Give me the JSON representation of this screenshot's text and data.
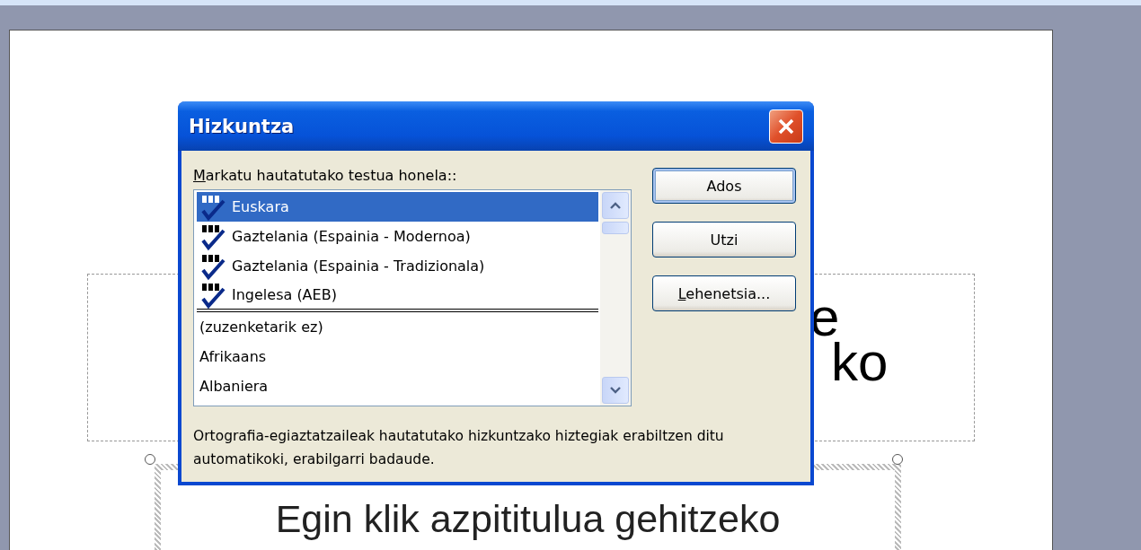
{
  "slide": {
    "title_fragments": [
      "e",
      "ko"
    ],
    "subtitle": "Egin klik azpititulua gehitzeko",
    "subtitle_selected": true
  },
  "dialog": {
    "title": "Hizkuntza",
    "label": "Markatu hautatutako testua honela::",
    "label_access_key_underlined": true,
    "languages": [
      {
        "name": "Euskara",
        "spellcheck": true,
        "selected": true,
        "divider_after": false
      },
      {
        "name": "Gaztelania (Espainia - Modernoa)",
        "spellcheck": true,
        "selected": false,
        "divider_after": false
      },
      {
        "name": "Gaztelania (Espainia - Tradizionala)",
        "spellcheck": true,
        "selected": false,
        "divider_after": false
      },
      {
        "name": "Ingelesa (AEB)",
        "spellcheck": true,
        "selected": false,
        "divider_after": true
      },
      {
        "name": "(zuzenketarik ez)",
        "spellcheck": false,
        "selected": false,
        "divider_after": false
      },
      {
        "name": "Afrikaans",
        "spellcheck": false,
        "selected": false,
        "divider_after": false
      },
      {
        "name": "Albaniera",
        "spellcheck": false,
        "selected": false,
        "divider_after": false
      }
    ],
    "buttons": [
      {
        "label": "Ados",
        "default": true,
        "access_key_underlined": false
      },
      {
        "label": "Utzi",
        "default": false,
        "access_key_underlined": false
      },
      {
        "label": "Lehenetsia...",
        "default": false,
        "access_key_underlined": true
      }
    ],
    "description": "Ortografia-egiaztatzaileak hautatutako hizkuntzako hiztegiak erabiltzen ditu automatikoki, erabilgarri badaude."
  }
}
